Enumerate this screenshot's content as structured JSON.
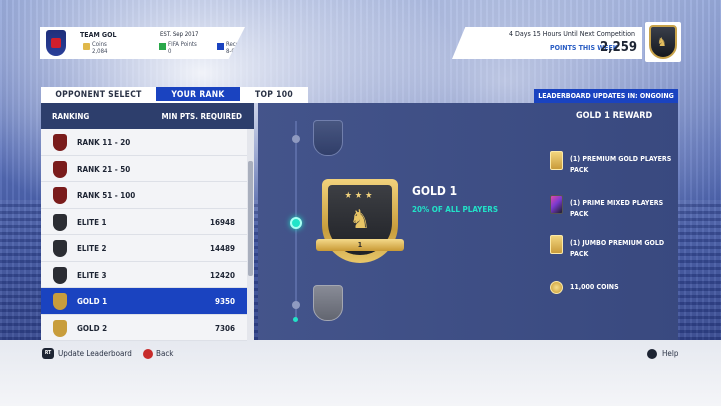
{
  "club": {
    "name": "TEAM GOL",
    "established": "EST. Sep 2017",
    "coins_label": "Coins",
    "coins_value": "2,084",
    "fifa_points_label": "FIFA Points",
    "fifa_points_value": "0",
    "record_label": "Record",
    "record_value": "8-0-0"
  },
  "competition": {
    "time_remaining": "4 Days 15 Hours Until Next Competition",
    "points_label": "POINTS THIS WEEK",
    "points_value": "2,259"
  },
  "tabs": {
    "opponent_select": "OPPONENT SELECT",
    "your_rank": "YOUR RANK",
    "top100": "TOP 100"
  },
  "leaderboard_status": "LEADERBOARD UPDATES IN: ONGOING",
  "ranking_panel": {
    "col_ranking": "RANKING",
    "col_min_pts": "MIN PTS. REQUIRED",
    "rows": [
      {
        "label": "RANK 11 - 20",
        "pts": "",
        "badge_color": "#7a1c1c"
      },
      {
        "label": "RANK 21 - 50",
        "pts": "",
        "badge_color": "#7a1c1c"
      },
      {
        "label": "RANK 51 - 100",
        "pts": "",
        "badge_color": "#7a1c1c"
      },
      {
        "label": "ELITE 1",
        "pts": "16948",
        "badge_color": "#2b2d33"
      },
      {
        "label": "ELITE 2",
        "pts": "14489",
        "badge_color": "#2b2d33"
      },
      {
        "label": "ELITE 3",
        "pts": "12420",
        "badge_color": "#2b2d33"
      },
      {
        "label": "GOLD 1",
        "pts": "9350",
        "badge_color": "#c89d3c"
      },
      {
        "label": "GOLD 2",
        "pts": "7306",
        "badge_color": "#c89d3c"
      }
    ],
    "selected_index": 6
  },
  "detail": {
    "tier_name": "GOLD 1",
    "tier_percent": "20% OF ALL PLAYERS",
    "badge_ribbon": "1",
    "reward_title": "GOLD 1 REWARD",
    "rewards": [
      {
        "text": "(1) PREMIUM GOLD PLAYERS PACK",
        "icon": "gold-pack-icon"
      },
      {
        "text": "(1) PRIME MIXED PLAYERS PACK",
        "icon": "mixed-pack-icon"
      },
      {
        "text": "(1) JUMBO PREMIUM GOLD PACK",
        "icon": "gold-pack-icon"
      },
      {
        "text": "11,000 COINS",
        "icon": "coins-icon"
      }
    ]
  },
  "footer": {
    "update_button_glyph": "RT",
    "update_label": "Update Leaderboard",
    "back_label": "Back",
    "help_label": "Help"
  },
  "colors": {
    "accent_blue": "#1a43c0",
    "highlight_teal": "#21e3c8",
    "gold": "#c89d3c"
  }
}
